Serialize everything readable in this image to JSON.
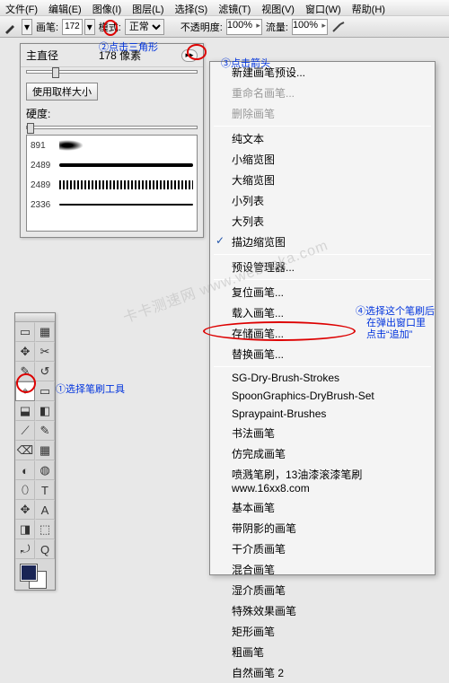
{
  "menu": [
    "文件(F)",
    "编辑(E)",
    "图像(I)",
    "图层(L)",
    "选择(S)",
    "滤镜(T)",
    "视图(V)",
    "窗口(W)",
    "帮助(H)"
  ],
  "optbar": {
    "brush_lbl": "画笔:",
    "brush_size": "172",
    "mode_lbl": "模式:",
    "mode_val": "正常",
    "opacity_lbl": "不透明度:",
    "opacity_val": "100%",
    "flow_lbl": "流量:",
    "flow_val": "100%"
  },
  "brushpanel": {
    "master_lbl": "主直径",
    "master_val": "178 像素",
    "use_sample": "使用取样大小",
    "hardness_lbl": "硬度:",
    "presets": [
      891,
      2489,
      2489,
      2336
    ]
  },
  "ctx": [
    {
      "t": "item",
      "txt": "新建画笔预设..."
    },
    {
      "t": "item",
      "txt": "重命名画笔...",
      "disabled": true
    },
    {
      "t": "item",
      "txt": "删除画笔",
      "disabled": true
    },
    {
      "t": "sep"
    },
    {
      "t": "item",
      "txt": "纯文本"
    },
    {
      "t": "item",
      "txt": "小缩览图"
    },
    {
      "t": "item",
      "txt": "大缩览图"
    },
    {
      "t": "item",
      "txt": "小列表"
    },
    {
      "t": "item",
      "txt": "大列表"
    },
    {
      "t": "item",
      "txt": "描边缩览图",
      "check": true
    },
    {
      "t": "sep"
    },
    {
      "t": "item",
      "txt": "预设管理器..."
    },
    {
      "t": "sep"
    },
    {
      "t": "item",
      "txt": "复位画笔..."
    },
    {
      "t": "item",
      "txt": "载入画笔..."
    },
    {
      "t": "item",
      "txt": "存储画笔..."
    },
    {
      "t": "item",
      "txt": "替换画笔..."
    },
    {
      "t": "sep"
    },
    {
      "t": "item",
      "txt": "SG-Dry-Brush-Strokes"
    },
    {
      "t": "item",
      "txt": "SpoonGraphics-DryBrush-Set"
    },
    {
      "t": "item",
      "txt": "Spraypaint-Brushes"
    },
    {
      "t": "item",
      "txt": "书法画笔"
    },
    {
      "t": "item",
      "txt": "仿完成画笔"
    },
    {
      "t": "item",
      "txt": "喷溅笔刷，13油漆滚漆笔刷www.16xx8.com"
    },
    {
      "t": "item",
      "txt": "基本画笔"
    },
    {
      "t": "item",
      "txt": "带阴影的画笔"
    },
    {
      "t": "item",
      "txt": "干介质画笔"
    },
    {
      "t": "item",
      "txt": "混合画笔"
    },
    {
      "t": "item",
      "txt": "湿介质画笔"
    },
    {
      "t": "item",
      "txt": "特殊效果画笔"
    },
    {
      "t": "item",
      "txt": "矩形画笔"
    },
    {
      "t": "item",
      "txt": "粗画笔"
    },
    {
      "t": "item",
      "txt": "自然画笔 2"
    }
  ],
  "hints": {
    "h1": "①选择笔刷工具",
    "h2": "②点击三角形",
    "h3": "③点击箭头",
    "h4a": "④选择这个笔刷后",
    "h4b": "在弹出窗口里",
    "h4c": "点击“追加”"
  },
  "watermark": "卡卡测速网 www.webkaka.com",
  "tools": [
    "▭",
    "▦",
    "✥",
    "✂",
    "✎",
    "↺",
    "⌖",
    "▭",
    "⬓",
    "◧",
    "⟋",
    "✎",
    "⌫",
    "▦",
    "◐",
    "◍",
    "⬯",
    "T",
    "✥",
    "A",
    "◨",
    "⬚",
    "⤾",
    "Q"
  ]
}
